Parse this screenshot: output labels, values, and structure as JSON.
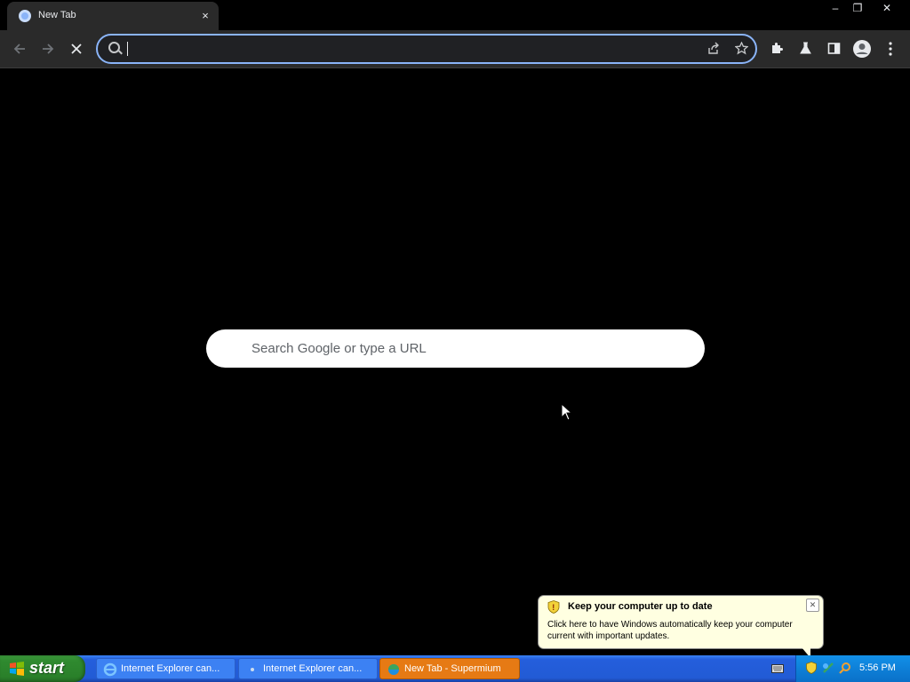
{
  "tab": {
    "title": "New Tab",
    "close": "×"
  },
  "window_controls": {
    "minimize": "–",
    "restore": "❐",
    "close": "✕"
  },
  "toolbar": {
    "back_icon": "arrow-left-icon",
    "forward_icon": "arrow-right-icon",
    "stop_icon": "stop-icon"
  },
  "omnibox": {
    "value": "",
    "placeholder": ""
  },
  "ntp": {
    "search_placeholder": "Search Google or type a URL"
  },
  "balloon": {
    "title": "Keep your computer up to date",
    "body": "Click here to have Windows automatically keep your computer current with important updates."
  },
  "taskbar": {
    "start_label": "start",
    "tasks": [
      {
        "label": "Internet Explorer can...",
        "active": false
      },
      {
        "label": "Internet Explorer can...",
        "active": false
      },
      {
        "label": "New Tab - Supermium",
        "active": true
      }
    ],
    "clock": "5:56 PM"
  },
  "colors": {
    "page_bg": "#000000",
    "chrome_bg": "#2a2a2a",
    "focus_ring": "#8ab4f8",
    "taskbar": "#245edc",
    "active_task": "#e67a14",
    "start_button": "#2f8a2f"
  }
}
